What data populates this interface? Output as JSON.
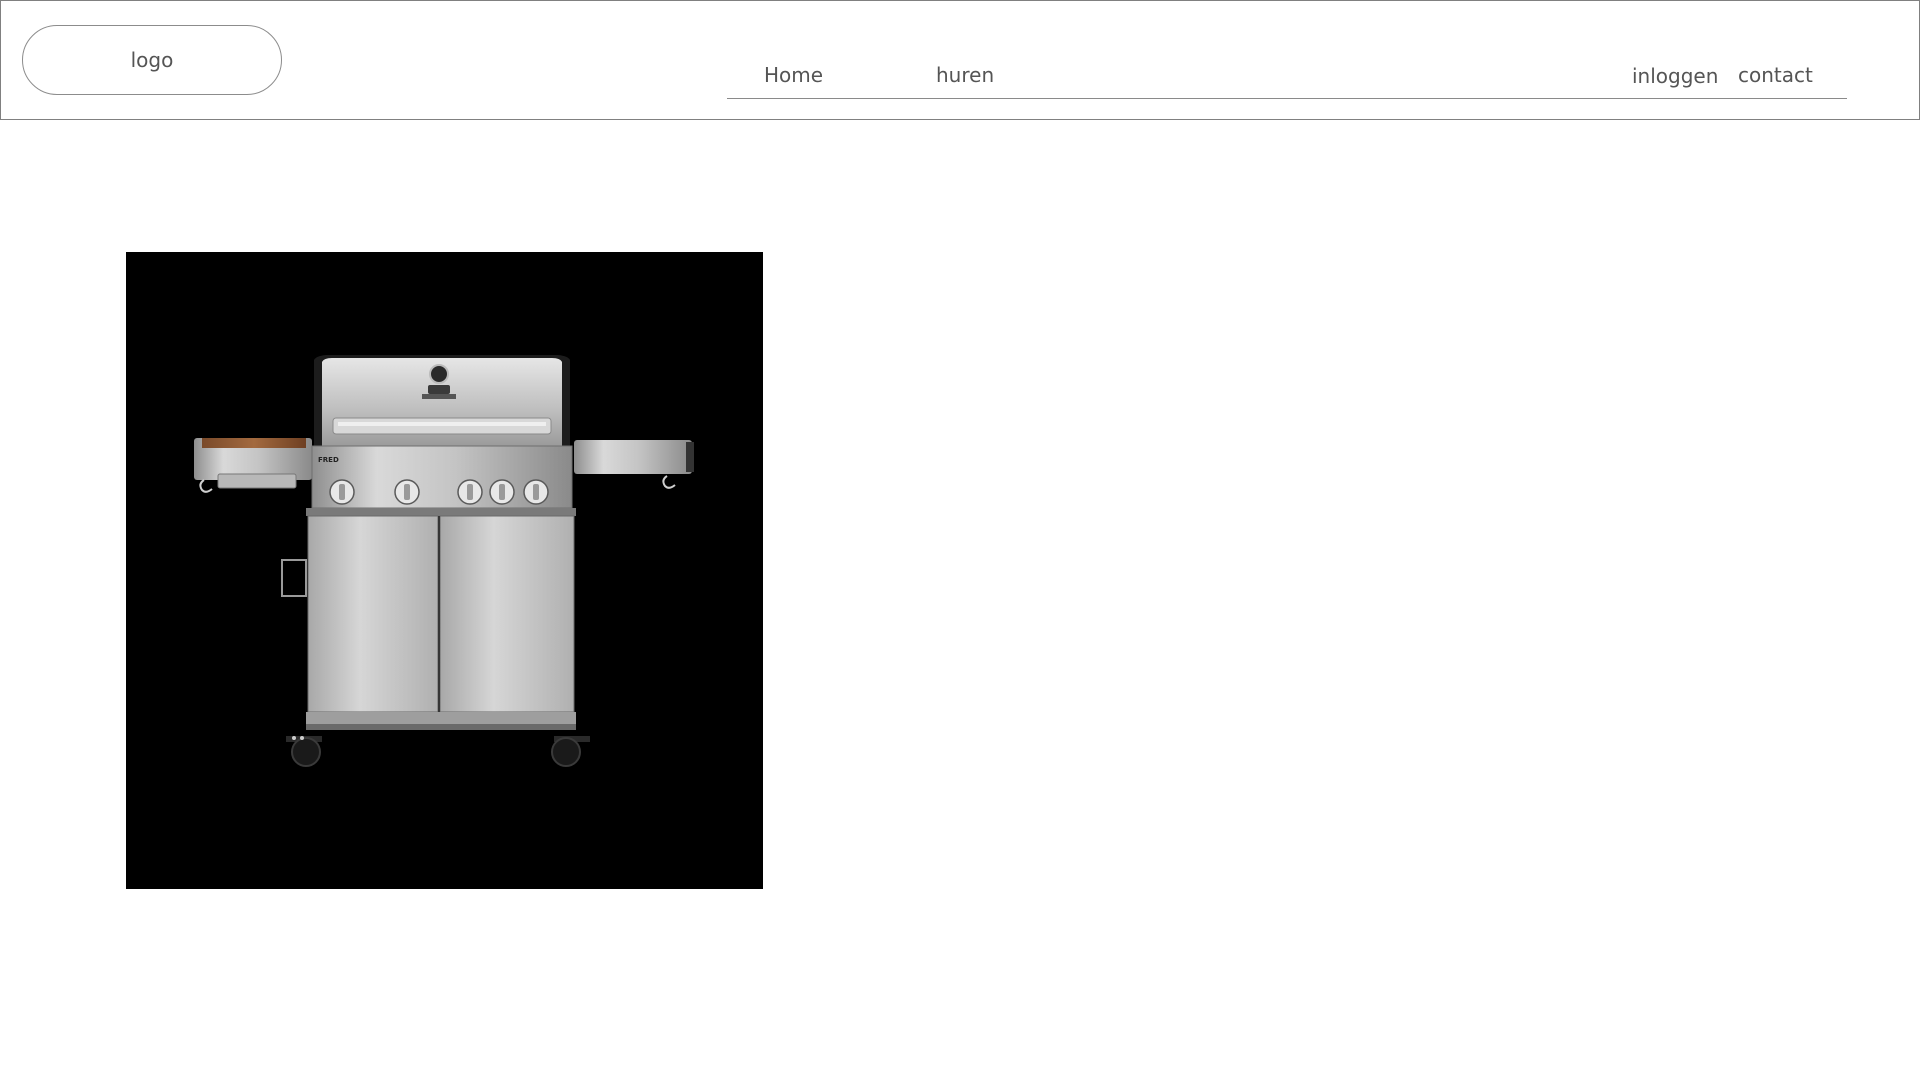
{
  "header": {
    "logo_label": "logo",
    "nav": {
      "home": "Home",
      "huren": "huren",
      "inloggen": "inloggen",
      "contact": "contact"
    }
  },
  "main": {
    "product_image": {
      "subject": "gas barbecue grill",
      "brand_text": "FRED",
      "background_color": "#000000"
    }
  },
  "colors": {
    "border": "#808080",
    "text": "#555555",
    "background": "#ffffff"
  }
}
